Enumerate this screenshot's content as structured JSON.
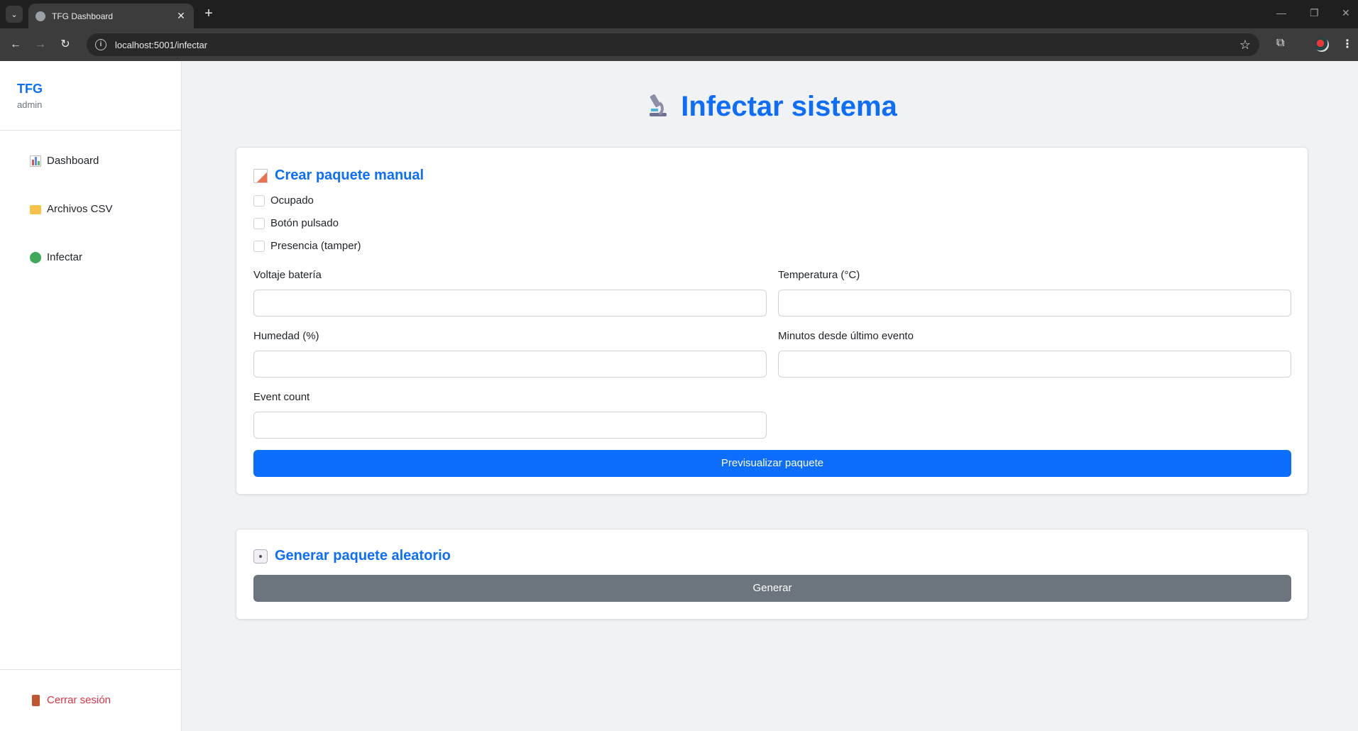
{
  "browser": {
    "tab_title": "TFG Dashboard",
    "url": "localhost:5001/infectar"
  },
  "sidebar": {
    "brand": "TFG",
    "user": "admin",
    "items": [
      {
        "label": "Dashboard",
        "icon": "bar-chart-icon"
      },
      {
        "label": "Archivos CSV",
        "icon": "folder-icon"
      },
      {
        "label": "Infectar",
        "icon": "virus-icon"
      }
    ],
    "logout_label": "Cerrar sesión"
  },
  "page": {
    "title": "Infectar sistema",
    "title_icon": "microscope-icon"
  },
  "manual_card": {
    "title": "Crear paquete manual",
    "icon": "memo-icon",
    "checkboxes": [
      {
        "label": "Ocupado",
        "checked": false
      },
      {
        "label": "Botón pulsado",
        "checked": false
      },
      {
        "label": "Presencia (tamper)",
        "checked": false
      }
    ],
    "fields": [
      {
        "label": "Voltaje batería",
        "value": ""
      },
      {
        "label": "Temperatura (°C)",
        "value": ""
      },
      {
        "label": "Humedad (%)",
        "value": ""
      },
      {
        "label": "Minutos desde último evento",
        "value": ""
      },
      {
        "label": "Event count",
        "value": ""
      }
    ],
    "preview_button": "Previsualizar paquete"
  },
  "random_card": {
    "title": "Generar paquete aleatorio",
    "icon": "dice-icon",
    "generate_button": "Generar"
  },
  "colors": {
    "primary": "#0d6efd",
    "secondary": "#6c757d",
    "danger": "#dc3545",
    "background": "#f1f2f4"
  }
}
